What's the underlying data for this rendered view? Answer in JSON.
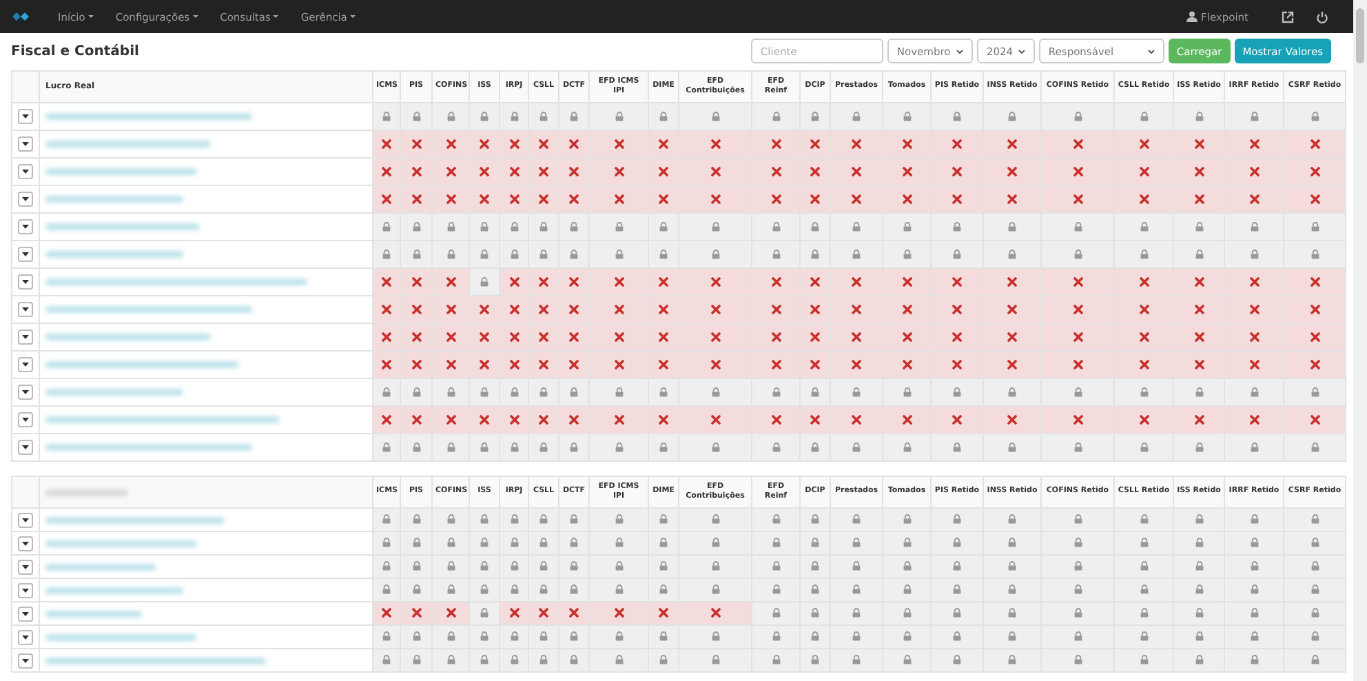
{
  "navbar": {
    "menus": [
      "Início",
      "Configurações",
      "Consultas",
      "Gerência"
    ],
    "user": "Flexpoint"
  },
  "page_title": "Fiscal e Contábil",
  "filters": {
    "client": {
      "placeholder": "Cliente"
    },
    "month": "Novembro",
    "year": "2024",
    "responsible": "Responsável",
    "buttons": [
      "Carregar",
      "Mostrar Valores"
    ]
  },
  "groups": [
    {
      "title": "Lucro Real",
      "columns": [
        "ICMS",
        "PIS",
        "COFINS",
        "ISS",
        "IRPJ",
        "CSLL",
        "DCTF",
        "EFD ICMS IPI",
        "DIME",
        "EFD Contribuições",
        "EFD Reinf",
        "DCIP",
        "Prestados",
        "Tomados",
        "PIS Retido",
        "INSS Retido",
        "COFINS Retido",
        "CSLL Retido",
        "ISS Retido",
        "IRRF Retido",
        "CSRF Retido"
      ],
      "rows": [
        {
          "missing": [
            false,
            false,
            false,
            false,
            false,
            false,
            false,
            false,
            false,
            false,
            false,
            false,
            false,
            false,
            false,
            false,
            false,
            false,
            false,
            false,
            false
          ]
        },
        {
          "missing": [
            true,
            true,
            true,
            true,
            true,
            true,
            true,
            true,
            true,
            true,
            true,
            true,
            true,
            true,
            true,
            true,
            true,
            true,
            true,
            true,
            true
          ]
        },
        {
          "missing": [
            true,
            true,
            true,
            true,
            true,
            true,
            true,
            true,
            true,
            true,
            true,
            true,
            true,
            true,
            true,
            true,
            true,
            true,
            true,
            true,
            true
          ]
        },
        {
          "missing": [
            true,
            true,
            true,
            true,
            true,
            true,
            true,
            true,
            true,
            true,
            true,
            true,
            true,
            true,
            true,
            true,
            true,
            true,
            true,
            true,
            true
          ]
        },
        {
          "missing": [
            false,
            false,
            false,
            false,
            false,
            false,
            false,
            false,
            false,
            false,
            false,
            false,
            false,
            false,
            false,
            false,
            false,
            false,
            false,
            false,
            false
          ]
        },
        {
          "missing": [
            false,
            false,
            false,
            false,
            false,
            false,
            false,
            false,
            false,
            false,
            false,
            false,
            false,
            false,
            false,
            false,
            false,
            false,
            false,
            false,
            false
          ]
        },
        {
          "missing": [
            true,
            true,
            true,
            false,
            true,
            true,
            true,
            true,
            true,
            true,
            true,
            true,
            true,
            true,
            true,
            true,
            true,
            true,
            true,
            true,
            true
          ]
        },
        {
          "missing": [
            true,
            true,
            true,
            true,
            true,
            true,
            true,
            true,
            true,
            true,
            true,
            true,
            true,
            true,
            true,
            true,
            true,
            true,
            true,
            true,
            true
          ]
        },
        {
          "missing": [
            true,
            true,
            true,
            true,
            true,
            true,
            true,
            true,
            true,
            true,
            true,
            true,
            true,
            true,
            true,
            true,
            true,
            true,
            true,
            true,
            true
          ]
        },
        {
          "missing": [
            true,
            true,
            true,
            true,
            true,
            true,
            true,
            true,
            true,
            true,
            true,
            true,
            true,
            true,
            true,
            true,
            true,
            true,
            true,
            true,
            true
          ]
        },
        {
          "missing": [
            false,
            false,
            false,
            false,
            false,
            false,
            false,
            false,
            false,
            false,
            false,
            false,
            false,
            false,
            false,
            false,
            false,
            false,
            false,
            false,
            false
          ]
        },
        {
          "missing": [
            true,
            true,
            true,
            true,
            true,
            true,
            true,
            true,
            true,
            true,
            true,
            true,
            true,
            true,
            true,
            true,
            true,
            true,
            true,
            true,
            true
          ]
        },
        {
          "missing": [
            false,
            false,
            false,
            false,
            false,
            false,
            false,
            false,
            false,
            false,
            false,
            false,
            false,
            false,
            false,
            false,
            false,
            false,
            false,
            false,
            false
          ]
        }
      ]
    },
    {
      "columns": [
        "ICMS",
        "PIS",
        "COFINS",
        "ISS",
        "IRPJ",
        "CSLL",
        "DCTF",
        "EFD ICMS IPI",
        "DIME",
        "EFD Contribuições",
        "EFD Reinf",
        "DCIP",
        "Prestados",
        "Tomados",
        "PIS Retido",
        "INSS Retido",
        "COFINS Retido",
        "CSLL Retido",
        "ISS Retido",
        "IRRF Retido",
        "CSRF Retido"
      ],
      "rows": [
        {
          "missing": [
            false,
            false,
            false,
            false,
            false,
            false,
            false,
            false,
            false,
            false,
            false,
            false,
            false,
            false,
            false,
            false,
            false,
            false,
            false,
            false,
            false
          ]
        },
        {
          "missing": [
            false,
            false,
            false,
            false,
            false,
            false,
            false,
            false,
            false,
            false,
            false,
            false,
            false,
            false,
            false,
            false,
            false,
            false,
            false,
            false,
            false
          ]
        },
        {
          "missing": [
            false,
            false,
            false,
            false,
            false,
            false,
            false,
            false,
            false,
            false,
            false,
            false,
            false,
            false,
            false,
            false,
            false,
            false,
            false,
            false,
            false
          ]
        },
        {
          "missing": [
            false,
            false,
            false,
            false,
            false,
            false,
            false,
            false,
            false,
            false,
            false,
            false,
            false,
            false,
            false,
            false,
            false,
            false,
            false,
            false,
            false
          ]
        },
        {
          "missing": [
            true,
            true,
            true,
            false,
            true,
            true,
            true,
            true,
            true,
            true,
            false,
            false,
            false,
            false,
            false,
            false,
            false,
            false,
            false,
            false,
            false
          ]
        },
        {
          "missing": [
            false,
            false,
            false,
            false,
            false,
            false,
            false,
            false,
            false,
            false,
            false,
            false,
            false,
            false,
            false,
            false,
            false,
            false,
            false,
            false,
            false
          ]
        },
        {
          "missing": [
            false,
            false,
            false,
            false,
            false,
            false,
            false,
            false,
            false,
            false,
            false,
            false,
            false,
            false,
            false,
            false,
            false,
            false,
            false,
            false,
            false
          ]
        }
      ]
    }
  ]
}
